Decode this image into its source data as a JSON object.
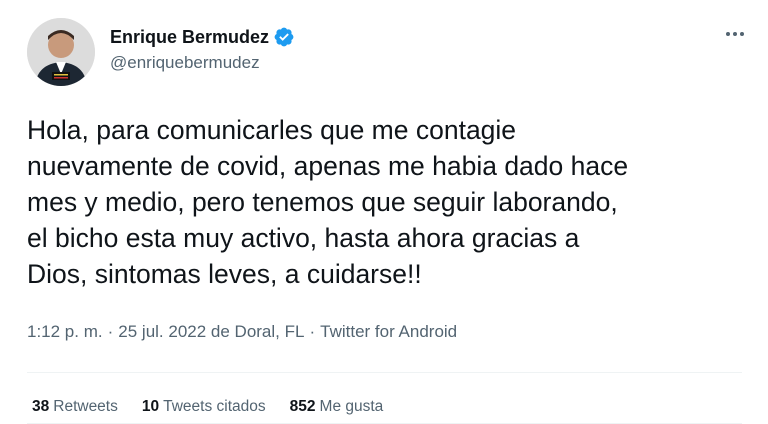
{
  "author": {
    "display_name": "Enrique Bermudez",
    "handle": "@enriquebermudez",
    "avatar_icon": "profile-photo",
    "verified_icon": "verified-badge-icon"
  },
  "more_icon": "more-options-icon",
  "tweet": {
    "text": "Hola, para comunicarles que me contagie\nnuevamente de covid, apenas me habia dado hace\nmes y medio, pero tenemos que seguir laborando,\nel bicho esta muy activo, hasta ahora gracias a\nDios, sintomas leves, a cuidarse!!"
  },
  "meta": {
    "time": "1:12 p. m.",
    "separator_1": "·",
    "date_location": "25 jul. 2022 de Doral, FL",
    "separator_2": "·",
    "client": "Twitter for Android"
  },
  "stats": [
    {
      "count": "38",
      "label": "Retweets"
    },
    {
      "count": "10",
      "label": "Tweets citados"
    },
    {
      "count": "852",
      "label": "Me gusta"
    }
  ],
  "colors": {
    "text_primary": "#0f1419",
    "text_secondary": "#536471",
    "verified_blue": "#1d9bf0",
    "divider": "#eff3f4"
  }
}
